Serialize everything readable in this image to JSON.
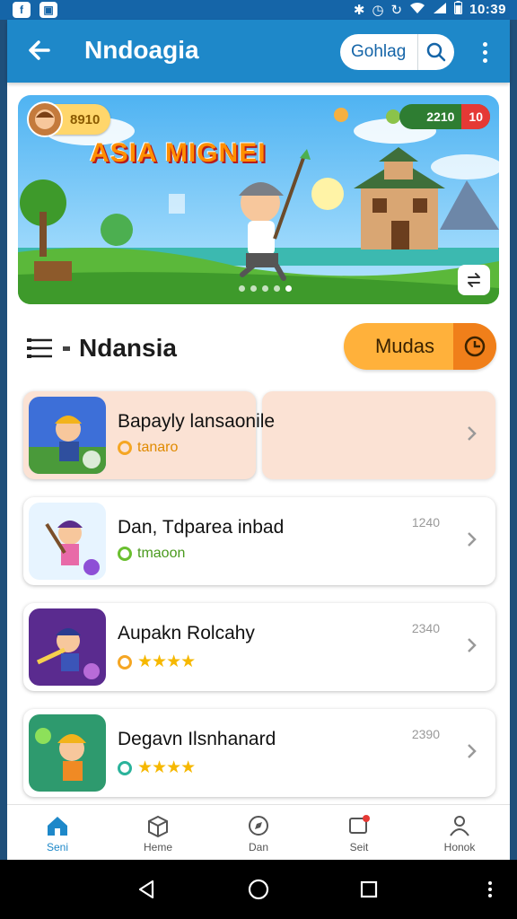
{
  "status_bar": {
    "time": "10:39"
  },
  "app_bar": {
    "title": "Nndoagia",
    "search_label": "Gohlag"
  },
  "banner": {
    "title": "ASIA MIGNEI",
    "coins": "8910",
    "score": "2210",
    "score_badge": "10",
    "dot_count": 5,
    "active_dot": 4
  },
  "section": {
    "title": "Ndansia",
    "sort_label": "Mudas"
  },
  "items": [
    {
      "title": "Bapayly lansaonile",
      "subtitle": "tanaro",
      "number": "",
      "rating": null,
      "accent": "#f5a623"
    },
    {
      "title": "Dan, Tdparea inbad",
      "subtitle": "tmaoon",
      "number": "1240",
      "rating": null,
      "accent": "#6abf2f"
    },
    {
      "title": "Aupakn Rolcahy",
      "subtitle": "",
      "number": "2340",
      "rating": 4,
      "accent": "#f5a623"
    },
    {
      "title": "Degavn Ilsnhanard",
      "subtitle": "",
      "number": "2390",
      "rating": 4,
      "accent": "#2bb39b"
    }
  ],
  "bottom_nav": [
    {
      "label": "Seni",
      "icon": "home-icon",
      "active": true
    },
    {
      "label": "Heme",
      "icon": "box-icon",
      "active": false
    },
    {
      "label": "Dan",
      "icon": "compass-icon",
      "active": false
    },
    {
      "label": "Seit",
      "icon": "message-icon",
      "active": false
    },
    {
      "label": "Honok",
      "icon": "profile-icon",
      "active": false
    }
  ]
}
